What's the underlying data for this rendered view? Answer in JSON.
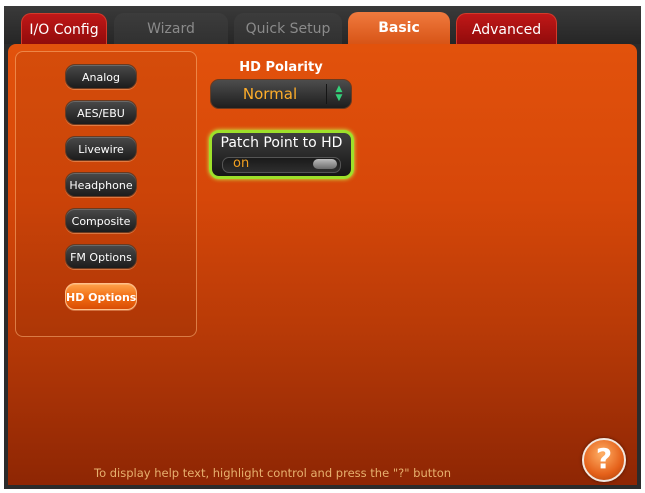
{
  "tabs": [
    {
      "label": "I/O Config",
      "state": "normal"
    },
    {
      "label": "Wizard",
      "state": "disabled"
    },
    {
      "label": "Quick Setup",
      "state": "disabled"
    },
    {
      "label": "Basic",
      "state": "active"
    },
    {
      "label": "Advanced",
      "state": "normal"
    }
  ],
  "sidebar": {
    "items": [
      {
        "label": "Analog"
      },
      {
        "label": "AES/EBU"
      },
      {
        "label": "Livewire"
      },
      {
        "label": "Headphone"
      },
      {
        "label": "Composite"
      },
      {
        "label": "FM Options"
      },
      {
        "label": "HD Options",
        "selected": true
      }
    ]
  },
  "controls": {
    "hd_polarity": {
      "label": "HD Polarity",
      "value": "Normal",
      "arrow_icon": "up-down-arrows-icon"
    },
    "patch_point": {
      "label": "Patch Point to HD",
      "state": "on"
    }
  },
  "footer": {
    "help_text": "To display help text, highlight control and press the \"?\" button",
    "help_button_label": "?"
  },
  "colors": {
    "panel_orange": "#d64709",
    "tab_red": "#b01414",
    "value_amber": "#ffae2a",
    "focus_green": "#9ee02a"
  }
}
